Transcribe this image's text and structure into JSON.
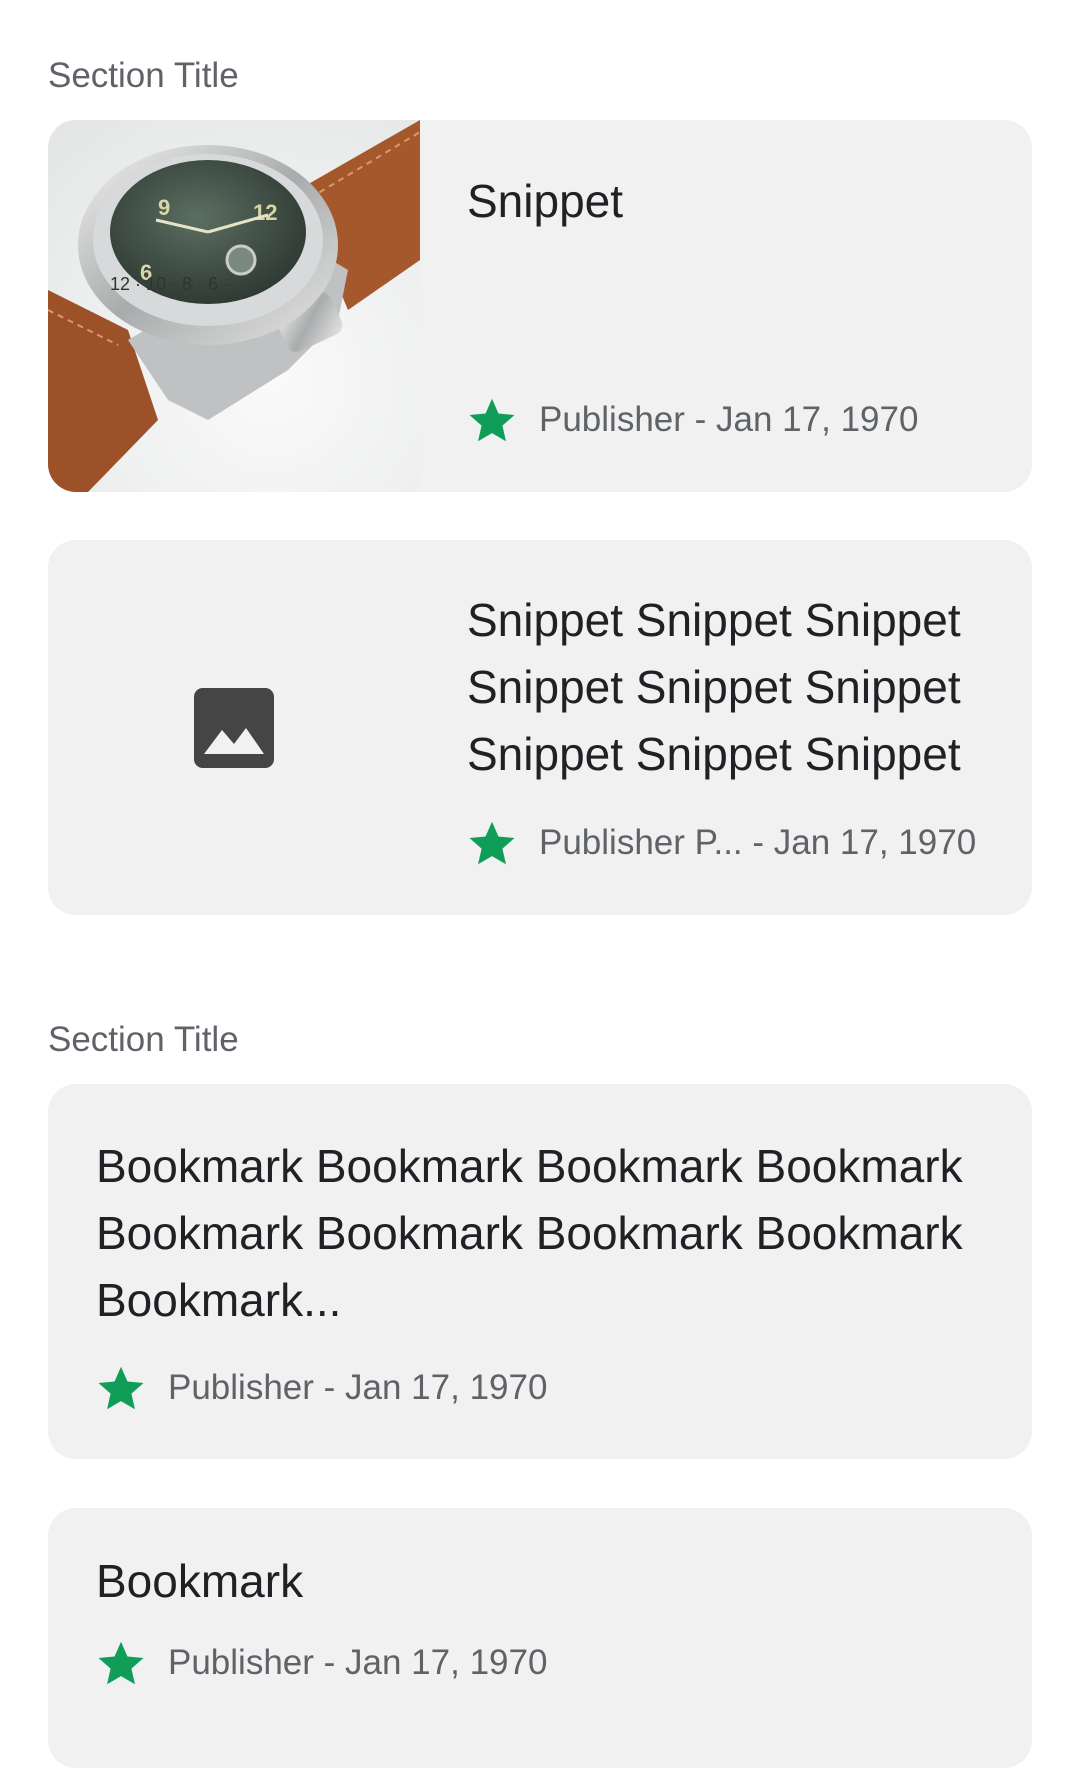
{
  "colors": {
    "accent_star": "#0f9d58",
    "card_bg": "#f1f1f1",
    "secondary_text": "#5f6368"
  },
  "sections": [
    {
      "title": "Section Title",
      "cards": [
        {
          "type": "snippet-with-image",
          "image_icon": "watch-photo",
          "title": "Snippet",
          "publisher": "Publisher",
          "separator": " - ",
          "date": "Jan 17, 1970"
        },
        {
          "type": "snippet-with-placeholder",
          "image_icon": "image-placeholder-icon",
          "title": "Snippet Snippet Snippet Snippet Snippet Snippet Snippet Snippet Snippet",
          "publisher": "Publisher P...",
          "separator": " - ",
          "date": "Jan 17, 1970"
        }
      ]
    },
    {
      "title": "Section Title",
      "cards": [
        {
          "type": "bookmark",
          "title": "Bookmark Bookmark Bookmark Bookmark Bookmark Bookmark Bookmark Bookmark Bookmark...",
          "publisher": "Publisher",
          "separator": " - ",
          "date": "Jan 17, 1970"
        },
        {
          "type": "bookmark",
          "title": "Bookmark",
          "publisher": "Publisher",
          "separator": " - ",
          "date": "Jan 17, 1970"
        }
      ]
    }
  ]
}
